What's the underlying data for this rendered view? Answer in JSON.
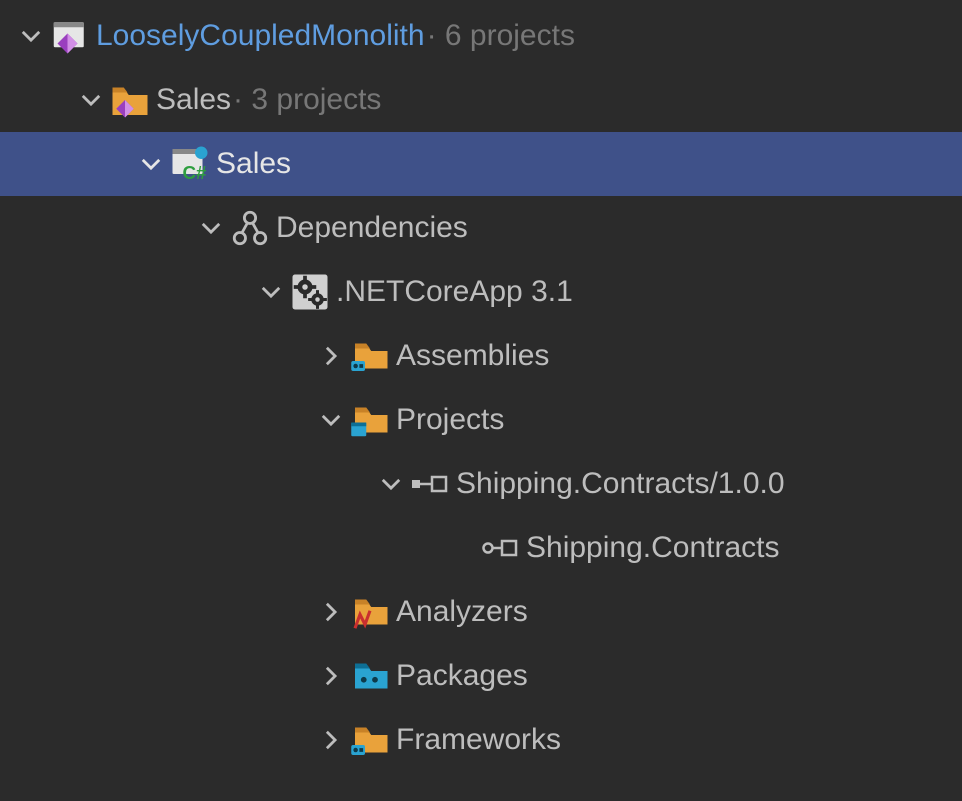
{
  "solution": {
    "name": "LooselyCoupledMonolith",
    "suffix": " · 6 projects"
  },
  "folder": {
    "name": "Sales",
    "suffix": " · 3 projects"
  },
  "project": {
    "name": "Sales"
  },
  "dependencies_label": "Dependencies",
  "framework_label": ".NETCoreApp 3.1",
  "assemblies_label": "Assemblies",
  "projects_label": "Projects",
  "ref_label": "Shipping.Contracts/1.0.0",
  "ref_child_label": "Shipping.Contracts",
  "analyzers_label": "Analyzers",
  "packages_label": "Packages",
  "frameworks_label": "Frameworks"
}
